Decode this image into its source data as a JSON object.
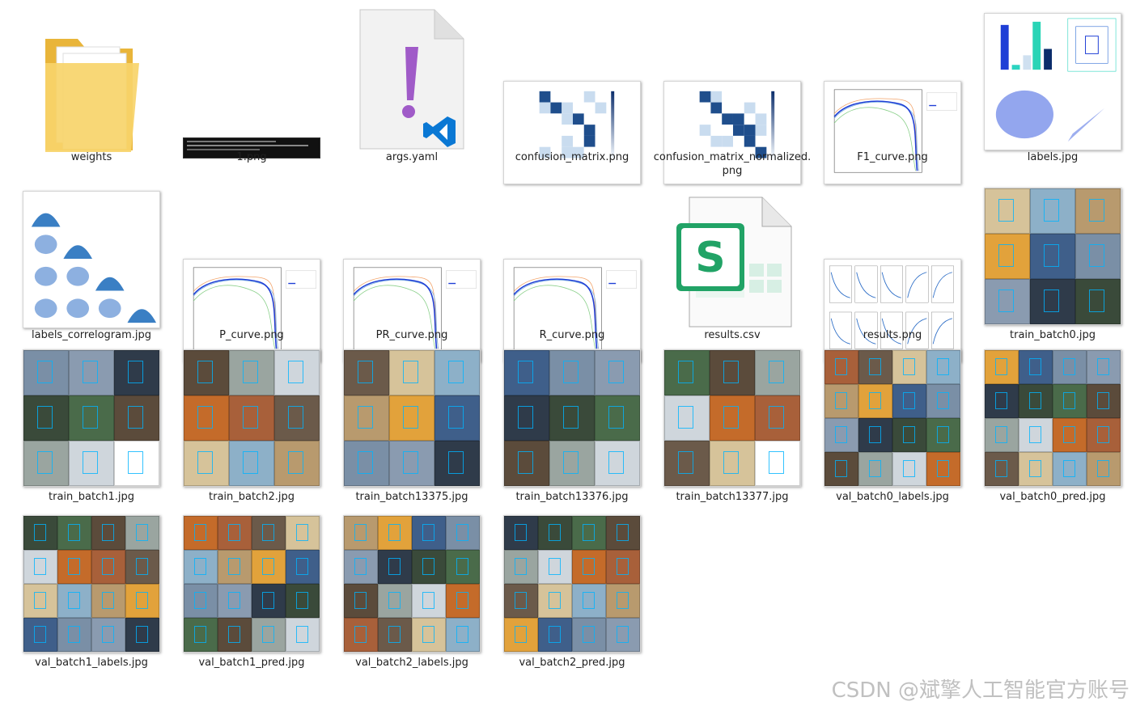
{
  "files": [
    {
      "name": "weights",
      "kind": "folder"
    },
    {
      "name": "1.png",
      "kind": "terminal"
    },
    {
      "name": "args.yaml",
      "kind": "yaml"
    },
    {
      "name": "confusion_matrix.png",
      "kind": "matrix"
    },
    {
      "name": "confusion_matrix_normalized.png",
      "kind": "matrix"
    },
    {
      "name": "F1_curve.png",
      "kind": "curve"
    },
    {
      "name": "labels.jpg",
      "kind": "labels"
    },
    {
      "name": "labels_correlogram.jpg",
      "kind": "correlogram"
    },
    {
      "name": "P_curve.png",
      "kind": "curve"
    },
    {
      "name": "PR_curve.png",
      "kind": "curve"
    },
    {
      "name": "R_curve.png",
      "kind": "curve"
    },
    {
      "name": "results.csv",
      "kind": "csv"
    },
    {
      "name": "results.png",
      "kind": "results"
    },
    {
      "name": "train_batch0.jpg",
      "kind": "photo"
    },
    {
      "name": "train_batch1.jpg",
      "kind": "photo"
    },
    {
      "name": "train_batch2.jpg",
      "kind": "photo"
    },
    {
      "name": "train_batch13375.jpg",
      "kind": "photo"
    },
    {
      "name": "train_batch13376.jpg",
      "kind": "photo"
    },
    {
      "name": "train_batch13377.jpg",
      "kind": "photo"
    },
    {
      "name": "val_batch0_labels.jpg",
      "kind": "photo4"
    },
    {
      "name": "val_batch0_pred.jpg",
      "kind": "photo4"
    },
    {
      "name": "val_batch1_labels.jpg",
      "kind": "photo4"
    },
    {
      "name": "val_batch1_pred.jpg",
      "kind": "photo4"
    },
    {
      "name": "val_batch2_labels.jpg",
      "kind": "photo4"
    },
    {
      "name": "val_batch2_pred.jpg",
      "kind": "photo4"
    }
  ],
  "labels_display": [
    "weights",
    "1.png",
    "args.yaml",
    "confusion_matrix.png",
    "confusion_matrix_normalized.p\nng",
    "F1_curve.png",
    "labels.jpg",
    "labels_correlogram.jpg",
    "P_curve.png",
    "PR_curve.png",
    "R_curve.png",
    "results.csv",
    "results.png",
    "train_batch0.jpg",
    "train_batch1.jpg",
    "train_batch2.jpg",
    "train_batch13375.jpg",
    "train_batch13376.jpg",
    "train_batch13377.jpg",
    "val_batch0_labels.jpg",
    "val_batch0_pred.jpg",
    "val_batch1_labels.jpg",
    "val_batch1_pred.jpg",
    "val_batch2_labels.jpg",
    "val_batch2_pred.jpg"
  ],
  "watermark": "CSDN @斌擎人工智能官方账号",
  "colors": {
    "folder": "#f5c542",
    "matrix": "#1f4e8c",
    "curve": "#1f3fd6",
    "excel": "#21a366",
    "yaml": "#a05bc8",
    "vscode": "#0a78d4"
  }
}
